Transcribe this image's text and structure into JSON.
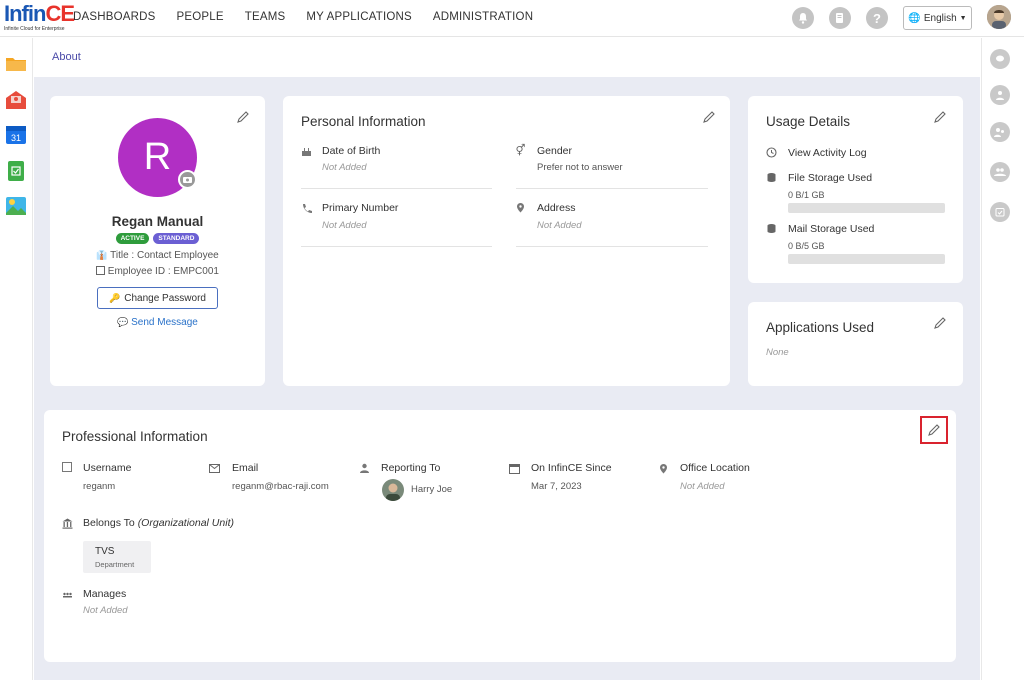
{
  "logo": {
    "big_a": "Infin",
    "big_b": "CE",
    "tagline": "Infinite Cloud for Enterprise"
  },
  "nav": [
    "DASHBOARDS",
    "PEOPLE",
    "TEAMS",
    "MY APPLICATIONS",
    "ADMINISTRATION"
  ],
  "language": "English",
  "breadcrumb": "About",
  "profile": {
    "initial": "R",
    "name": "Regan Manual",
    "badges": [
      "ACTIVE",
      "STANDARD"
    ],
    "title": "Title : Contact Employee",
    "employee_id": "Employee ID : EMPC001",
    "change_password": "Change Password",
    "send_message": "Send Message"
  },
  "personal": {
    "heading": "Personal Information",
    "dob_label": "Date of Birth",
    "dob_value": "Not Added",
    "gender_label": "Gender",
    "gender_value": "Prefer not to answer",
    "phone_label": "Primary Number",
    "phone_value": "Not Added",
    "address_label": "Address",
    "address_value": "Not Added"
  },
  "usage": {
    "heading": "Usage Details",
    "activity": "View Activity Log",
    "file_label": "File Storage Used",
    "file_value": "0 B/1 GB",
    "file_fraction": 0,
    "mail_label": "Mail Storage Used",
    "mail_value": "0 B/5 GB",
    "mail_fraction": 0
  },
  "apps": {
    "heading": "Applications Used",
    "value": "None"
  },
  "professional": {
    "heading": "Professional Information",
    "username_label": "Username",
    "username_value": "reganm",
    "email_label": "Email",
    "email_value": "reganm@rbac-raji.com",
    "reporting_label": "Reporting To",
    "reporting_value": "Harry Joe",
    "since_label": "On InfinCE Since",
    "since_value": "Mar 7, 2023",
    "office_label": "Office Location",
    "office_value": "Not Added",
    "belongs_label": "Belongs To",
    "belongs_suffix": "(Organizational Unit)",
    "unit_name": "TVS",
    "unit_type": "Department",
    "manages_label": "Manages",
    "manages_value": "Not Added"
  },
  "colors": {
    "accent": "#4a4aa8",
    "avatar": "#b12fc4",
    "active": "#2e9c3c",
    "standard": "#6b5fd3",
    "highlight": "#d9232e"
  }
}
